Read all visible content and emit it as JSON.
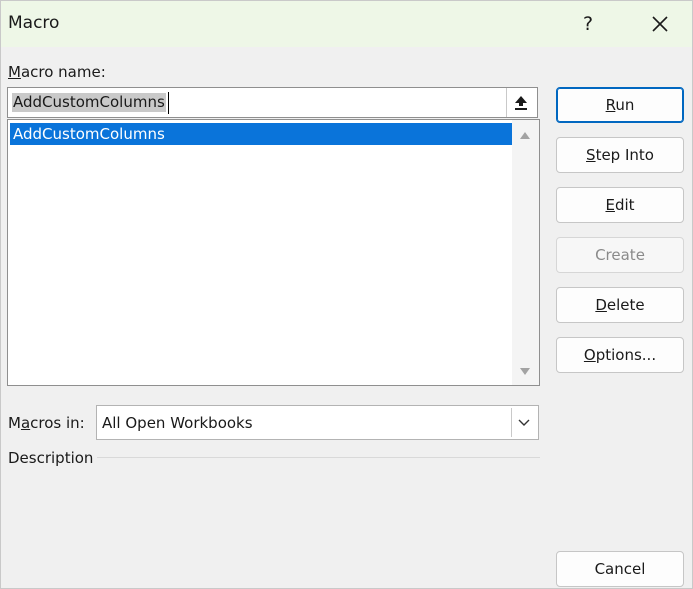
{
  "dialog": {
    "title": "Macro",
    "help_label": "?"
  },
  "macro_name": {
    "label_prefix": "M",
    "label_rest": "acro name:",
    "value": "AddCustomColumns"
  },
  "macro_list": {
    "items": [
      "AddCustomColumns"
    ],
    "selected_index": 0
  },
  "buttons": {
    "run": {
      "mnemonic": "R",
      "rest": "un"
    },
    "step_into": {
      "mnemonic": "S",
      "rest": "tep Into"
    },
    "edit": {
      "mnemonic": "E",
      "rest": "dit"
    },
    "create": {
      "label": "Create",
      "enabled": false
    },
    "delete": {
      "mnemonic": "D",
      "rest": "elete"
    },
    "options": {
      "mnemonic": "O",
      "rest": "ptions..."
    },
    "cancel": {
      "label": "Cancel"
    }
  },
  "macros_in": {
    "label_pre": "M",
    "label_mnemonic": "a",
    "label_post": "cros in:",
    "selected": "All Open Workbooks"
  },
  "description": {
    "label": "Description"
  },
  "icons": {
    "help": "help-icon",
    "close": "close-icon",
    "collapse": "upload-arrow-icon",
    "scroll_up": "scroll-up-icon",
    "scroll_down": "scroll-down-icon",
    "dropdown": "chevron-down-icon"
  },
  "colors": {
    "title_bar": "#eef7e7",
    "selection": "#0a74da",
    "primary_border": "#0067c0"
  }
}
